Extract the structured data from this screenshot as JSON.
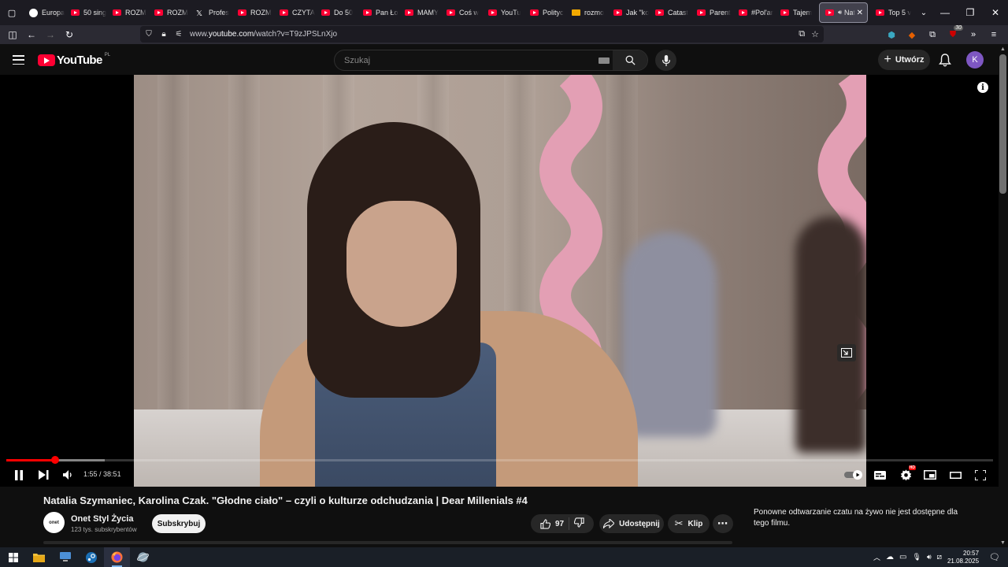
{
  "browser": {
    "tabs": [
      {
        "label": "Europa",
        "favicon": "globe"
      },
      {
        "label": "50 sing",
        "favicon": "youtube"
      },
      {
        "label": "ROZM",
        "favicon": "youtube"
      },
      {
        "label": "ROZM",
        "favicon": "youtube"
      },
      {
        "label": "Profes",
        "favicon": "x"
      },
      {
        "label": "ROZM",
        "favicon": "youtube"
      },
      {
        "label": "CZYTA",
        "favicon": "youtube"
      },
      {
        "label": "Do 50",
        "favicon": "youtube"
      },
      {
        "label": "Pan Ło",
        "favicon": "youtube"
      },
      {
        "label": "MAMY",
        "favicon": "youtube"
      },
      {
        "label": "Coś w",
        "favicon": "youtube"
      },
      {
        "label": "YouTu",
        "favicon": "youtube"
      },
      {
        "label": "Polityc",
        "favicon": "youtube"
      },
      {
        "label": "rozmo",
        "favicon": "jp"
      },
      {
        "label": "Jak \"ko",
        "favicon": "youtube"
      },
      {
        "label": "Catast",
        "favicon": "youtube"
      },
      {
        "label": "Parent",
        "favicon": "youtube"
      },
      {
        "label": "#Pol'ar",
        "favicon": "youtube"
      },
      {
        "label": "Tajem",
        "favicon": "youtube"
      }
    ],
    "active_tab": {
      "label": "Nat",
      "favicon": "youtube"
    },
    "after_tabs": [
      {
        "label": "Top 5 v",
        "favicon": "youtube"
      }
    ],
    "url_prefix": "www.",
    "url_domain": "youtube.com",
    "url_rest": "/watch?v=T9zJPSLnXjo",
    "ext_badge": "30"
  },
  "youtube": {
    "logo_text": "YouTube",
    "country_code": "PL",
    "search_placeholder": "Szukaj",
    "create_label": "Utwórz",
    "avatar_letter": "K"
  },
  "player": {
    "current_time": "1:55",
    "duration": "38:51",
    "progress_fraction": 0.0493,
    "buffered_fraction": 0.1
  },
  "video": {
    "title": "Natalia Szymaniec, Karolina Czak. \"Głodne ciało\" – czyli o kulturze odchudzania | Dear Millenials #4",
    "channel_name": "Onet Styl Życia",
    "channel_avatar_text": "onet",
    "subscribers": "123 tys. subskrybentów",
    "subscribe_label": "Subskrybuj",
    "likes": "97",
    "share_label": "Udostępnij",
    "clip_label": "Klip"
  },
  "chat": {
    "message": "Ponowne odtwarzanie czatu na żywo nie jest dostępne dla tego filmu."
  },
  "taskbar": {
    "time": "20:57",
    "date": "21.08.2025"
  }
}
